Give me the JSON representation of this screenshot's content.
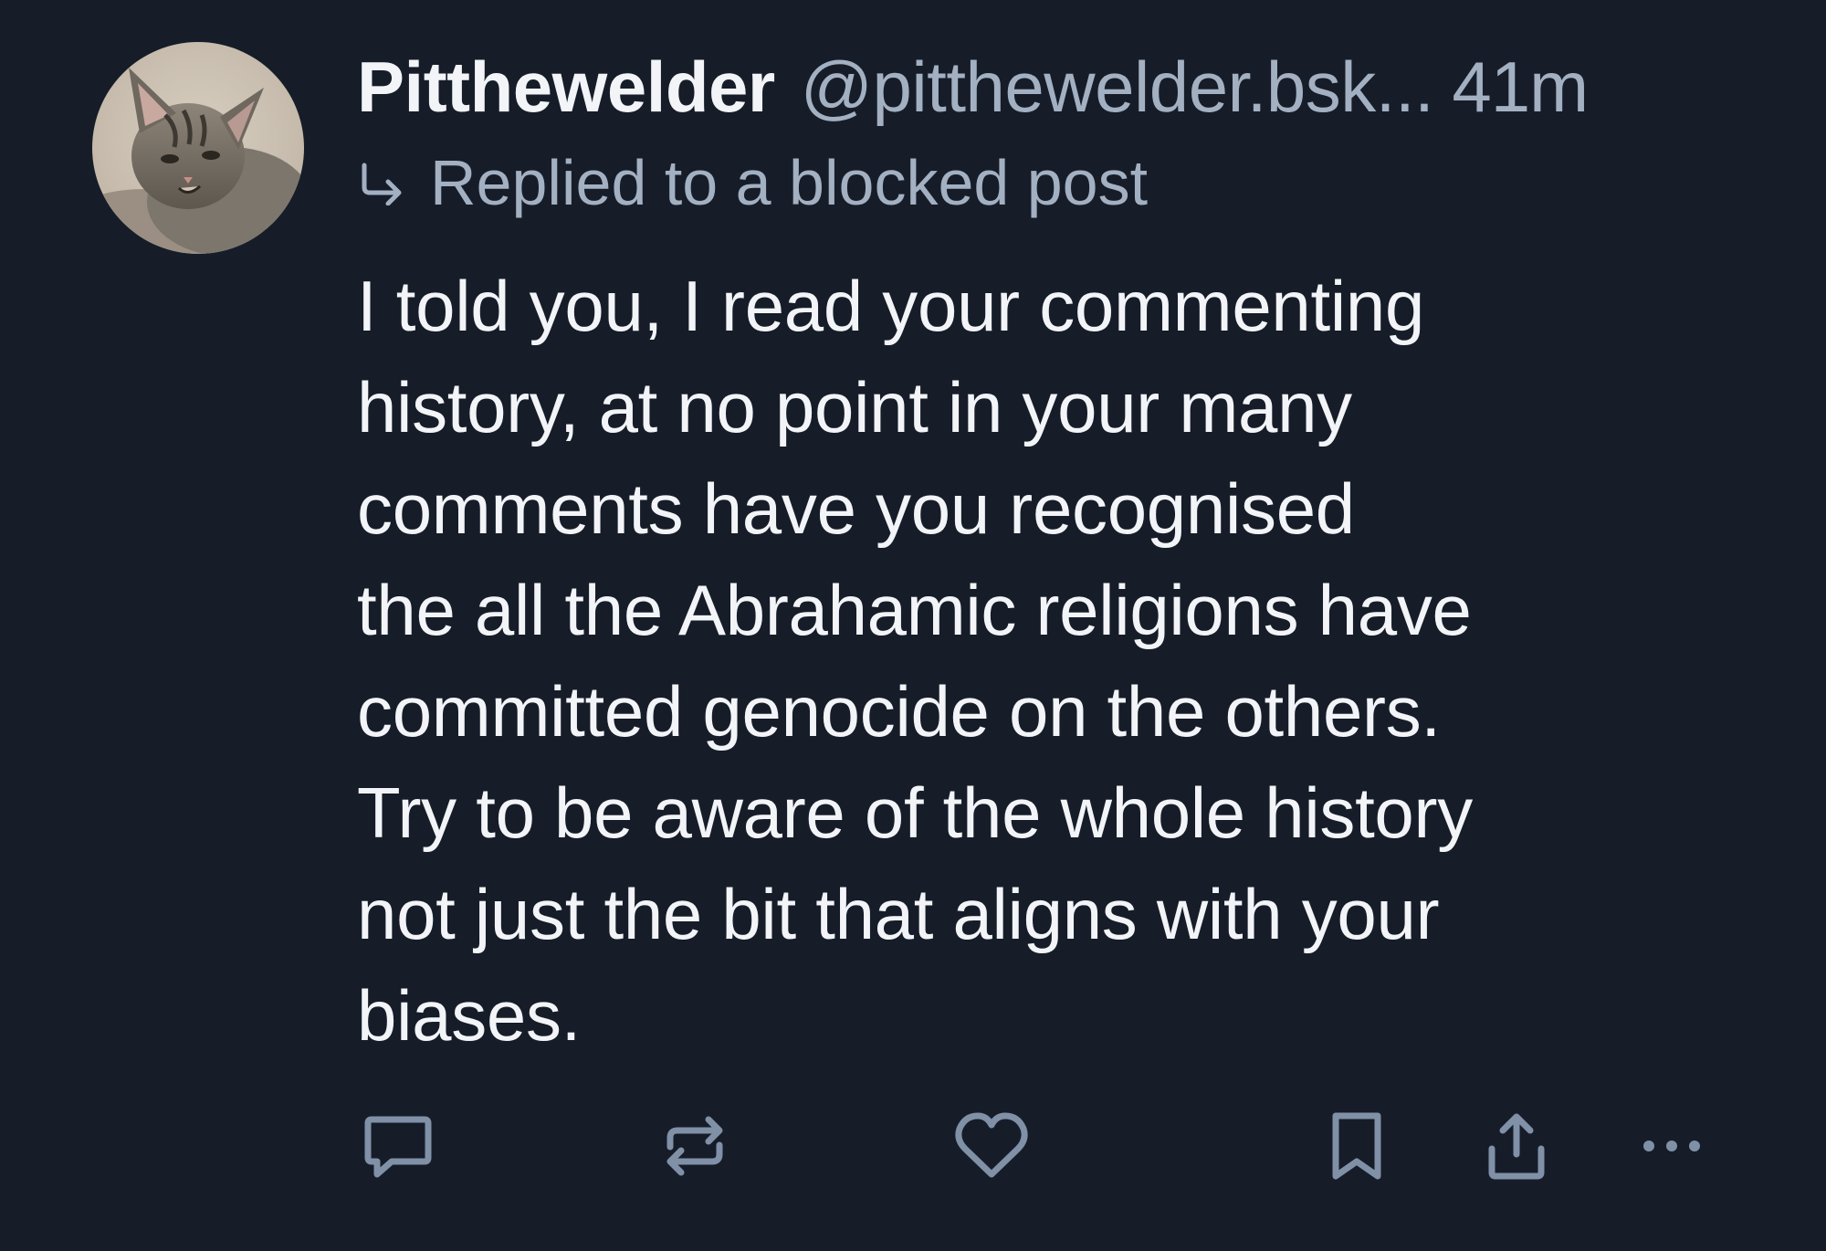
{
  "post": {
    "author": {
      "display_name": "Pitthewelder",
      "handle": "@pitthewelder.bsk...",
      "avatar_icon": "kitten-avatar"
    },
    "separator": " ",
    "timestamp": "41m",
    "reply_context": {
      "icon": "reply-arrow-icon",
      "text": "Replied to a blocked post"
    },
    "body": "I told you, I read your commenting\nhistory, at no point in your many\ncomments have you recognised\nthe all the Abrahamic religions have\ncommitted genocide on the others.\nTry to be aware of the whole history\nnot just the bit that aligns with your\nbiases."
  },
  "actions": [
    {
      "name": "reply",
      "icon": "comment-icon"
    },
    {
      "name": "repost",
      "icon": "repost-icon"
    },
    {
      "name": "like",
      "icon": "heart-icon"
    },
    {
      "name": "bookmark",
      "icon": "bookmark-icon"
    },
    {
      "name": "share",
      "icon": "share-icon"
    },
    {
      "name": "more",
      "icon": "more-dots-icon"
    }
  ],
  "colors": {
    "background": "#161d29",
    "primary_text": "#f2f4f7",
    "secondary_text": "#a3b0c2",
    "icon": "#8090a6"
  }
}
